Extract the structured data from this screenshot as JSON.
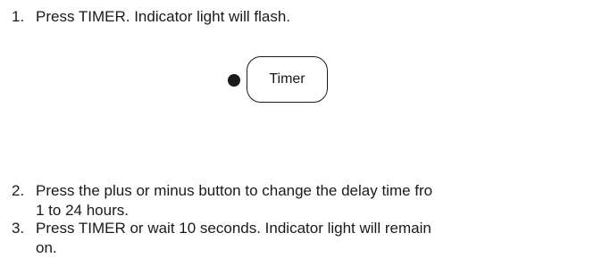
{
  "steps": [
    {
      "number": "1.",
      "lines": [
        "Press TIMER. Indicator light will flash."
      ]
    },
    {
      "number": "2.",
      "lines": [
        "Press the plus or minus button to change the delay time fro",
        "1 to 24 hours."
      ]
    },
    {
      "number": "3.",
      "lines": [
        "Press TIMER or wait 10 seconds. Indicator light will remain",
        "on."
      ]
    }
  ],
  "control": {
    "button_label": "Timer"
  },
  "colors": {
    "text": "#1a1a1a",
    "background": "#ffffff"
  }
}
